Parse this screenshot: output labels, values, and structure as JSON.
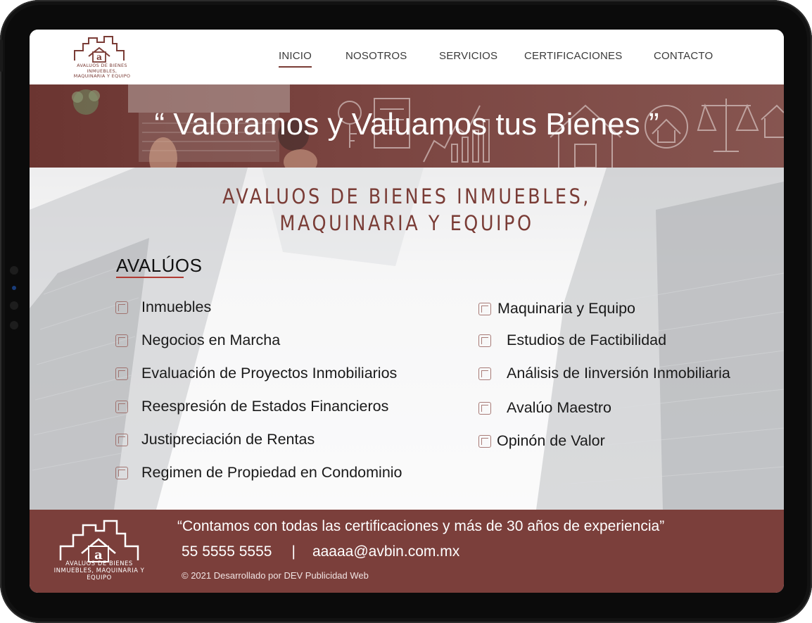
{
  "brand": {
    "logo_text": "AVALUOS DE BIENES INMUEBLES, MAQUINARIA Y EQUIPO",
    "color_primary": "#7b3f3b"
  },
  "nav": {
    "items": [
      {
        "label": "INICIO",
        "active": true
      },
      {
        "label": "NOSOTROS",
        "active": false
      },
      {
        "label": "SERVICIOS",
        "active": false
      },
      {
        "label": "CERTIFICACIONES",
        "active": false
      },
      {
        "label": "CONTACTO",
        "active": false
      }
    ]
  },
  "hero": {
    "title": "“ Valoramos y Valuamos tus Bienes ”"
  },
  "main": {
    "subtitle_line1": "AVALUOS DE BIENES INMUEBLES,",
    "subtitle_line2": "MAQUINARIA Y EQUIPO",
    "section_title": "AVALÚOS",
    "left_services": [
      {
        "label": "Inmuebles",
        "icon": "buildings-icon"
      },
      {
        "label": "Negocios en Marcha",
        "icon": "growth-chart-icon"
      },
      {
        "label": "Evaluación de Proyectos Inmobiliarios",
        "icon": "project-plan-icon"
      },
      {
        "label": "Reespresión de Estados Financieros",
        "icon": "financial-statement-icon"
      },
      {
        "label": "Justipreciación de Rentas",
        "icon": "rent-hand-icon"
      },
      {
        "label": "Regimen de Propiedad en Condominio",
        "icon": "condominium-icon"
      }
    ],
    "right_services": [
      {
        "label": "Maquinaria y Equipo",
        "icon": "gears-icon"
      },
      {
        "label": "Estudios de Factibilidad",
        "icon": "feasibility-doc-icon"
      },
      {
        "label": "Análisis de Iinversión Inmobiliaria",
        "icon": "magnifier-house-icon"
      },
      {
        "label": "Avalúo Maestro",
        "icon": "houses-icon"
      },
      {
        "label": "Opinón de Valor",
        "icon": "value-hand-icon"
      }
    ]
  },
  "footer": {
    "quote": "“Contamos con todas las certificaciones y más de 30 años de experiencia”",
    "phone": "55  5555 5555",
    "separator": "|",
    "email": "aaaaa@avbin.com.mx",
    "copyright": "© 2021 Desarrollado por DEV Publicidad Web",
    "logo_text": "AVALUOS DE BIENES INMUEBLES, MAQUINARIA Y EQUIPO"
  }
}
